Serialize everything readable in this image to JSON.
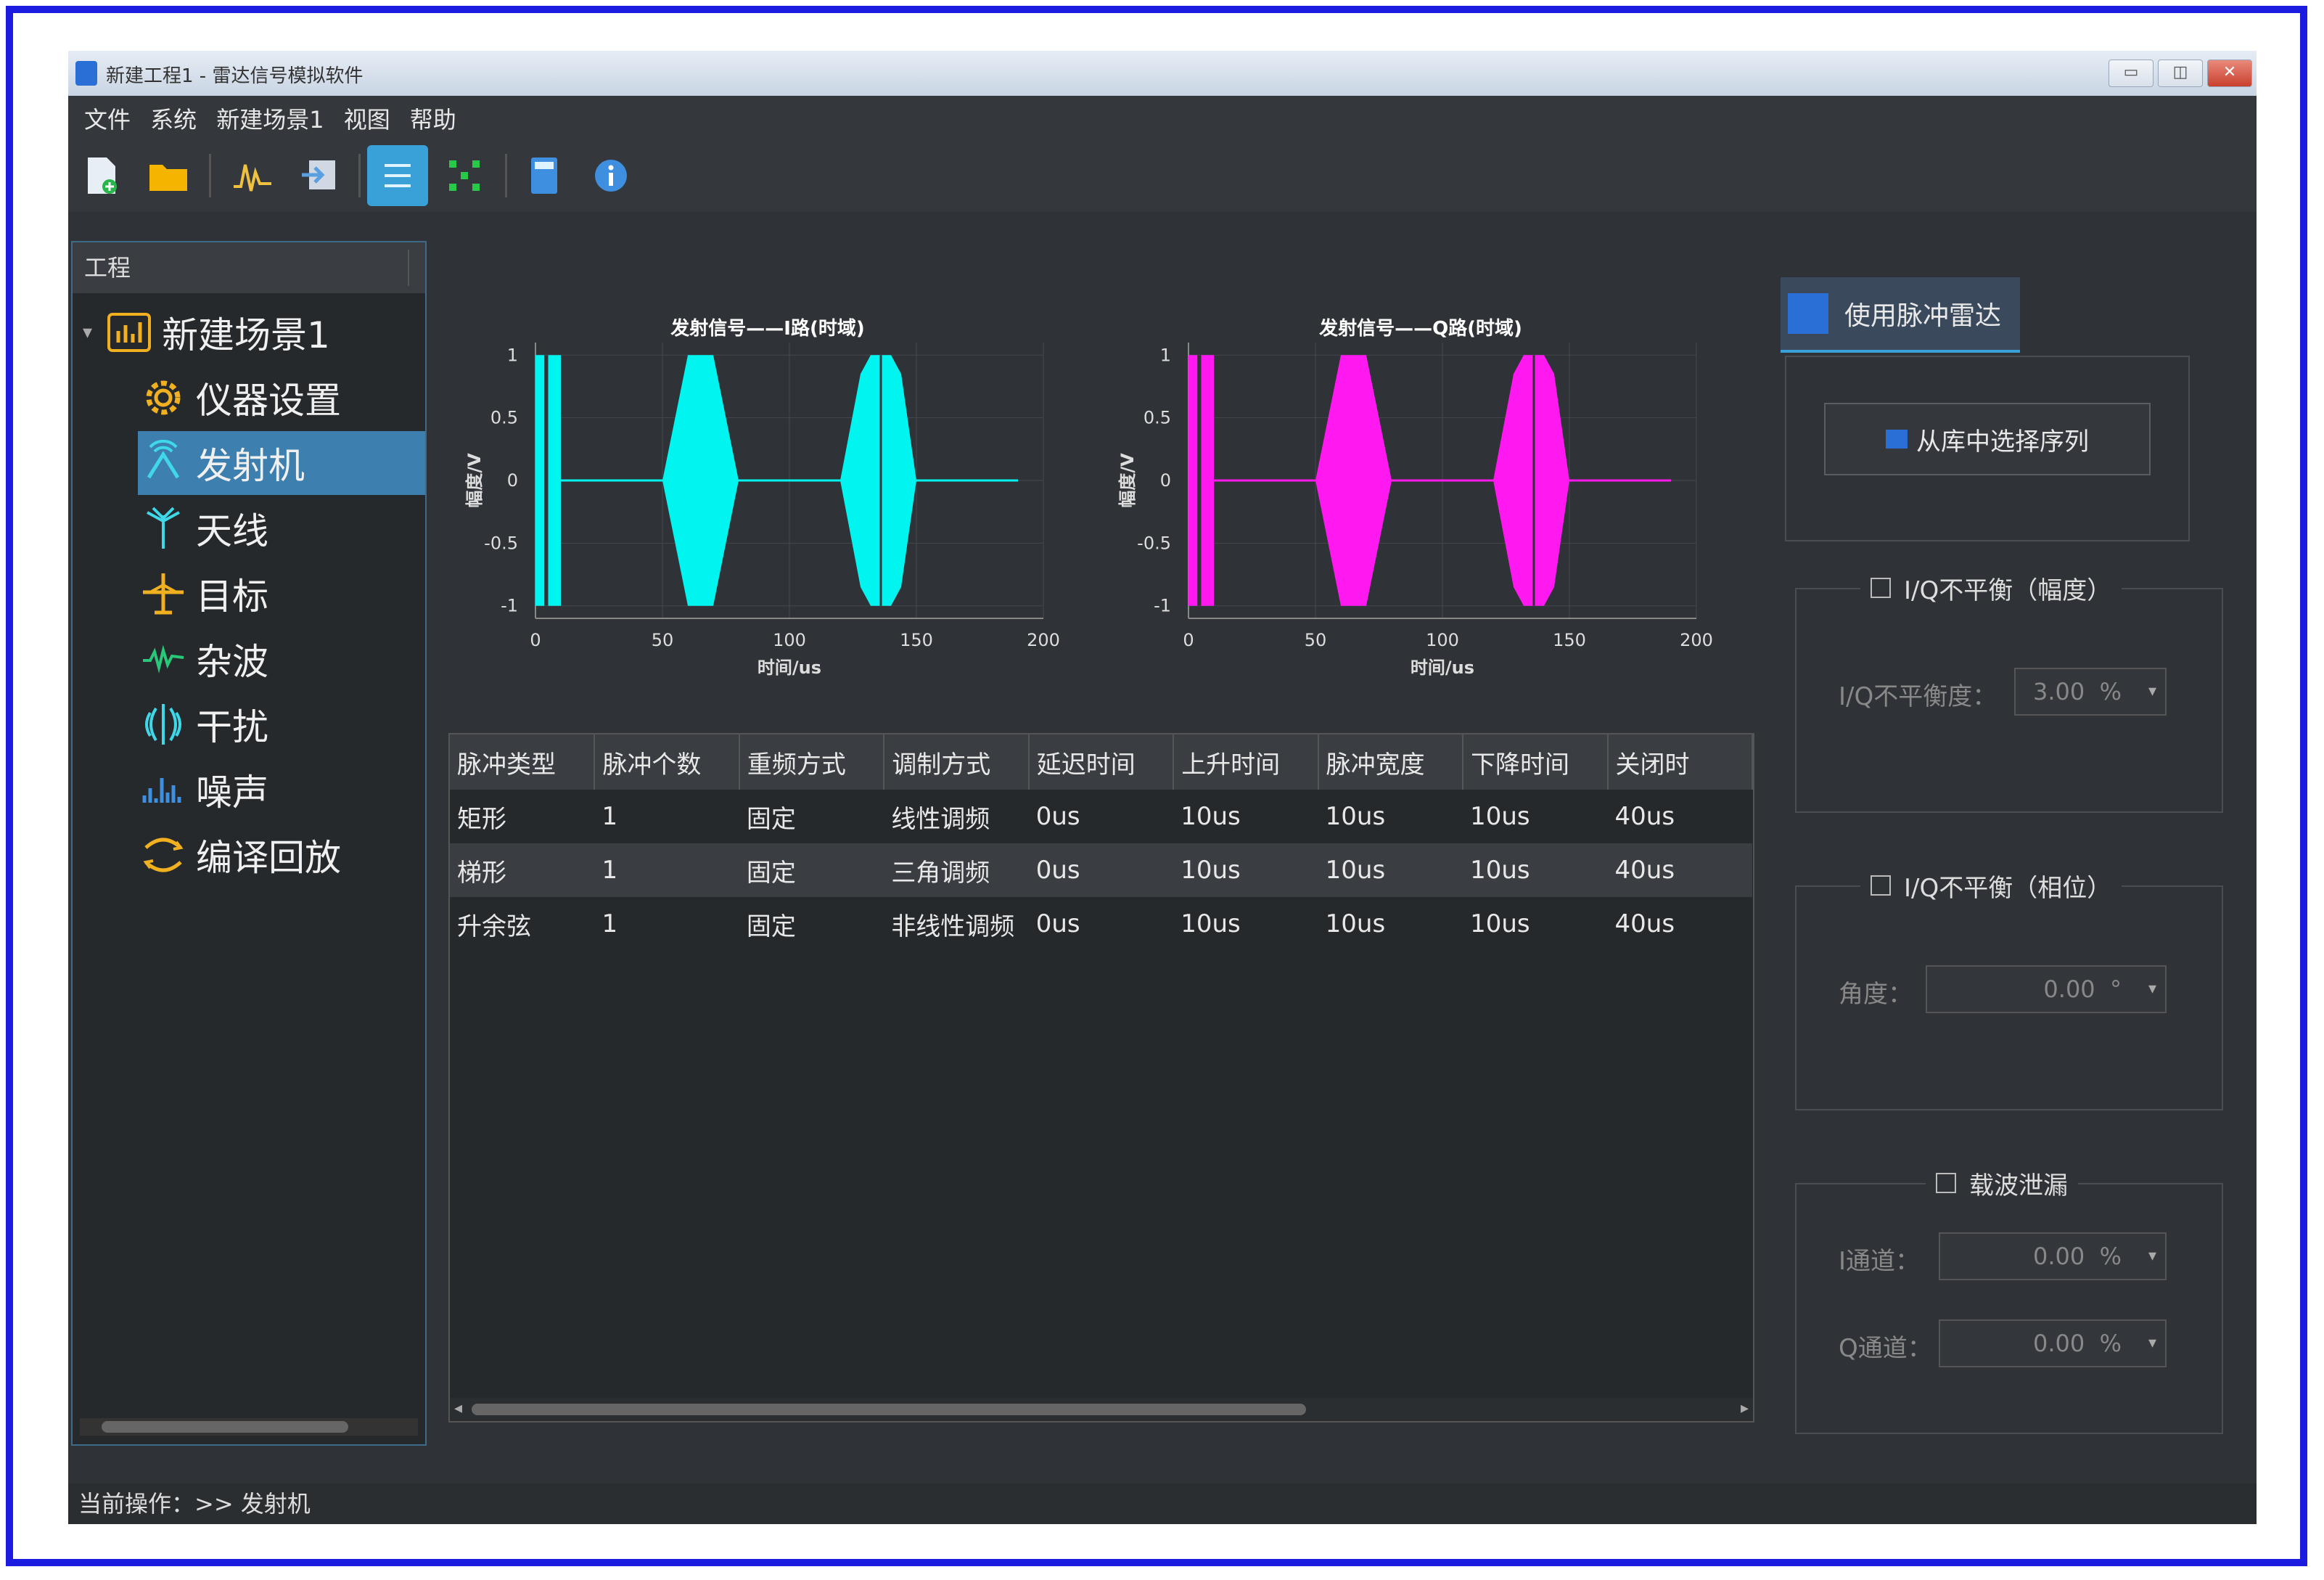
{
  "window": {
    "title": "新建工程1 - 雷达信号模拟软件",
    "btn_min": "▭",
    "btn_max": "◫",
    "btn_close": "✕"
  },
  "menu": [
    "文件",
    "系统",
    "新建场景1",
    "视图",
    "帮助"
  ],
  "toolbar_icons": [
    "new-file-icon",
    "open-folder-icon",
    "waveform-icon",
    "export-icon",
    "list-view-icon",
    "grid-view-icon",
    "calculator-icon",
    "info-icon"
  ],
  "sidebar": {
    "header": "工程",
    "root": "新建场景1",
    "items": [
      "仪器设置",
      "发射机",
      "天线",
      "目标",
      "杂波",
      "干扰",
      "噪声",
      "编译回放"
    ],
    "selected": "发射机"
  },
  "charts": [
    {
      "title": "发射信号——I路(时域)",
      "ylabel": "幅度/V",
      "xlabel": "时间/us",
      "xticks": [
        "0",
        "50",
        "100",
        "150",
        "200"
      ],
      "yticks": [
        "1",
        "0.5",
        "0",
        "-0.5",
        "-1"
      ],
      "color": "#00f5f0"
    },
    {
      "title": "发射信号——Q路(时域)",
      "ylabel": "幅度/V",
      "xlabel": "时间/us",
      "xticks": [
        "0",
        "50",
        "100",
        "150",
        "200"
      ],
      "yticks": [
        "1",
        "0.5",
        "0",
        "-0.5",
        "-1"
      ],
      "color": "#ff19f0"
    }
  ],
  "table": {
    "columns": [
      "脉冲类型",
      "脉冲个数",
      "重频方式",
      "调制方式",
      "延迟时间",
      "上升时间",
      "脉冲宽度",
      "下降时间",
      "关闭时"
    ],
    "rows": [
      [
        "矩形",
        "1",
        "固定",
        "线性调频",
        "0us",
        "10us",
        "10us",
        "10us",
        "40us"
      ],
      [
        "梯形",
        "1",
        "固定",
        "三角调频",
        "0us",
        "10us",
        "10us",
        "10us",
        "40us"
      ],
      [
        "升余弦",
        "1",
        "固定",
        "非线性调频",
        "0us",
        "10us",
        "10us",
        "10us",
        "40us"
      ]
    ]
  },
  "right": {
    "tab_label": "使用脉冲雷达",
    "select_btn": "从库中选择序列",
    "iq_amp": {
      "title": "I/Q不平衡（幅度）",
      "label": "I/Q不平衡度：",
      "value": "3.00",
      "unit": "%"
    },
    "iq_phase": {
      "title": "I/Q不平衡（相位）",
      "label": "角度：",
      "value": "0.00",
      "unit": "°"
    },
    "carrier": {
      "title": "载波泄漏",
      "i_label": "I通道：",
      "i_value": "0.00",
      "i_unit": "%",
      "q_label": "Q通道：",
      "q_value": "0.00",
      "q_unit": "%"
    }
  },
  "status": "当前操作：>> 发射机"
}
